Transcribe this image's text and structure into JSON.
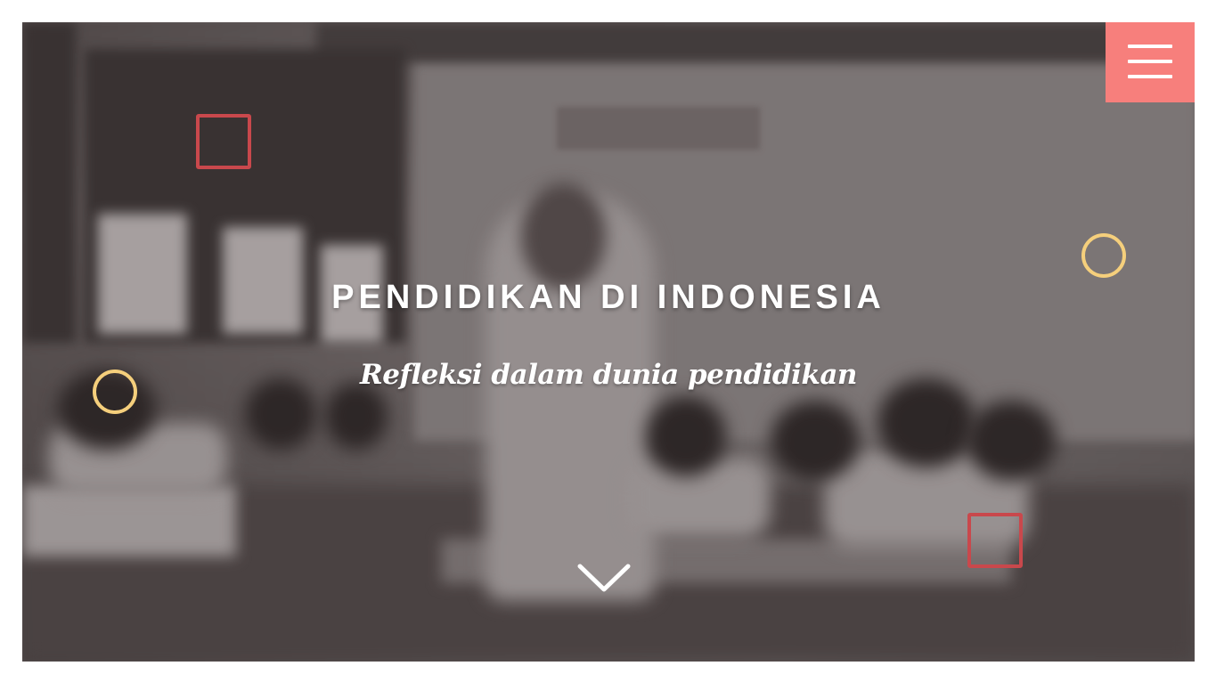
{
  "hero": {
    "title": "PENDIDIKAN DI INDONESIA",
    "subtitle": "Refleksi dalam dunia pendidikan"
  },
  "icons": {
    "menu": "hamburger-menu-icon",
    "scroll": "chevron-down-icon"
  },
  "colors": {
    "accent": "#f77f7c",
    "square_decoration": "#c9484c",
    "circle_decoration": "#f5cf7c",
    "text": "#ffffff"
  }
}
